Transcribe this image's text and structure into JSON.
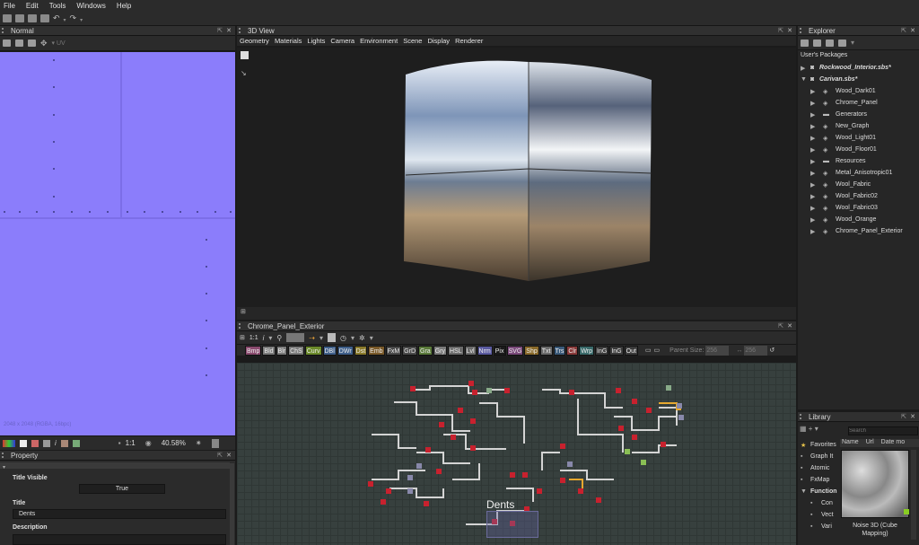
{
  "menu": [
    "File",
    "Edit",
    "Tools",
    "Windows",
    "Help"
  ],
  "normal_panel": {
    "title": "Normal",
    "zoom": "40.58%",
    "info": "2048 x 2048 (RGBA, 16bpc)",
    "ratio": "1:1"
  },
  "property_panel": {
    "title": "Property",
    "title_visible_label": "Title Visible",
    "title_visible_value": "True",
    "title_label": "Title",
    "title_value": "Dents",
    "description_label": "Description"
  },
  "view3d": {
    "title": "3D View",
    "menu": [
      "Geometry",
      "Materials",
      "Lights",
      "Camera",
      "Environment",
      "Scene",
      "Display",
      "Renderer"
    ]
  },
  "graph": {
    "title": "Chrome_Panel_Exterior",
    "ratio": "1:1",
    "filters": [
      "Bmp",
      "Bld",
      "Blr",
      "ChS",
      "Curv",
      "DBl",
      "DWr",
      "Dst",
      "Emb",
      "FxM",
      "GrD",
      "Gra",
      "Gry",
      "HSL",
      "Lvl",
      "Nrm",
      "Pix",
      "SVG",
      "Shp",
      "Txt",
      "Trs",
      "Clr",
      "Wrp",
      "InG",
      "InG",
      "Out"
    ],
    "filter_colors": [
      "#8a4a6e",
      "#7a7a7a",
      "#7a7a7a",
      "#7a7a7a",
      "#6b8a2a",
      "#3f5f8a",
      "#3f5f8a",
      "#8a7a2a",
      "#7a5a2a",
      "#4a4a4a",
      "#4a4a4a",
      "#5a7a3a",
      "#7a7a7a",
      "#6a6a6a",
      "#6a6a6a",
      "#5a5aa0",
      "#1a1a1a",
      "#7a4a7a",
      "#8a6a2a",
      "#6a6a6a",
      "#3a5a7a",
      "#8a3a3a",
      "#3a6a6a",
      "#3a3a3a",
      "#3a3a3a",
      "#3a3a3a"
    ],
    "parent_size_label": "Parent Size:",
    "parent_size_1": "256",
    "parent_size_2": "256",
    "frame_label": "Dents"
  },
  "explorer": {
    "title": "Explorer",
    "section": "User's Packages",
    "packages": [
      "Rockwood_Interior.sbs*",
      "Carivan.sbs*"
    ],
    "items": [
      "Wood_Dark01",
      "Chrome_Panel",
      "Generators",
      "New_Graph",
      "Wood_Light01",
      "Wood_Floor01",
      "Resources",
      "Metal_Anisotropic01",
      "Wool_Fabric",
      "Wool_Fabric02",
      "Wool_Fabric03",
      "Wood_Orange",
      "Chrome_Panel_Exterior"
    ],
    "item_types": [
      "graph",
      "graph",
      "folder",
      "graph",
      "graph",
      "graph",
      "folder",
      "graph",
      "graph",
      "graph",
      "graph",
      "graph",
      "graph"
    ]
  },
  "library": {
    "title": "Library",
    "search_placeholder": "Search",
    "columns": [
      "Name",
      "Url",
      "Date mo"
    ],
    "items": [
      "Favorites",
      "Graph It",
      "Atomic",
      "FxMap",
      "Function"
    ],
    "sub_items": [
      "Con",
      "Vect",
      "Vari"
    ],
    "thumb_label": "Noise 3D (Cube Mapping)"
  }
}
